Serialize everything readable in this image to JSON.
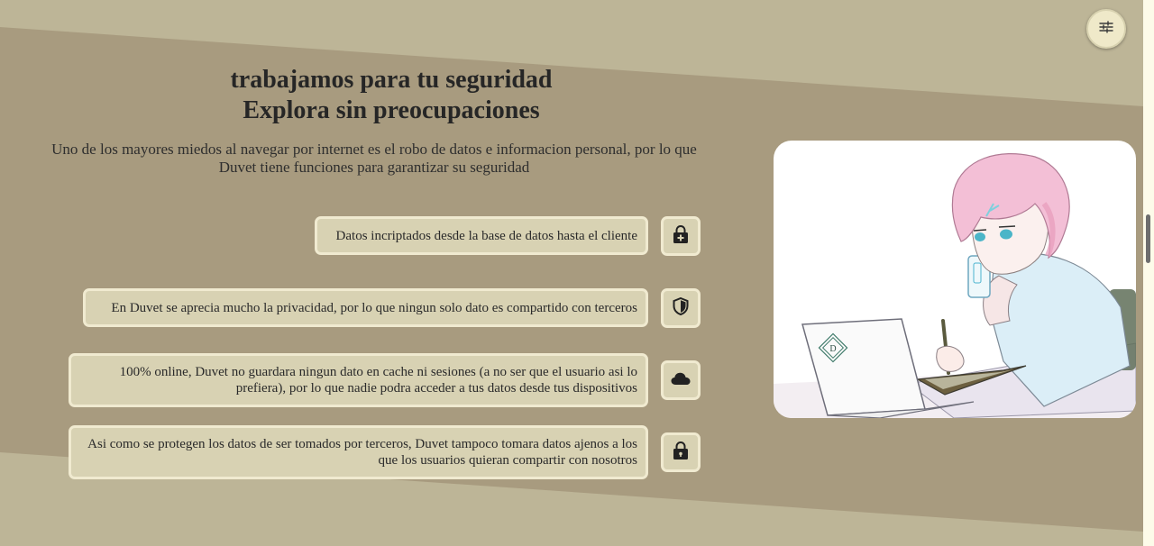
{
  "header": {
    "title_line1": "trabajamos para tu seguridad",
    "title_line2": "Explora sin preocupaciones"
  },
  "intro": {
    "text": "Uno de los mayores miedos al navegar por internet es el robo de datos e informacion personal, por lo que Duvet tiene funciones para garantizar su seguridad"
  },
  "features": [
    {
      "text": "Datos incriptados desde la base de datos hasta el cliente",
      "icon": "lock-plus-icon"
    },
    {
      "text": "En Duvet se aprecia mucho la privacidad, por lo que ningun solo dato es compartido con terceros",
      "icon": "shield-icon"
    },
    {
      "text": "100% online, Duvet no guardara ningun dato en cache ni sesiones (a no ser que el usuario asi lo prefiera), por lo que nadie podra acceder a tus datos desde tus dispositivos",
      "icon": "cloud-icon"
    },
    {
      "text": "Asi como se protegen los datos de ser tomados por terceros, Duvet tampoco tomara datos ajenos a los que los usuarios quieran compartir con nosotros",
      "icon": "lock-icon"
    }
  ],
  "illustration": {
    "laptop_logo": "D"
  },
  "colors": {
    "background": "#bdb597",
    "band": "#a89b7f",
    "card": "#d8d2b3",
    "card_border": "#f0ead0",
    "settings_button": "#efe9c9"
  }
}
